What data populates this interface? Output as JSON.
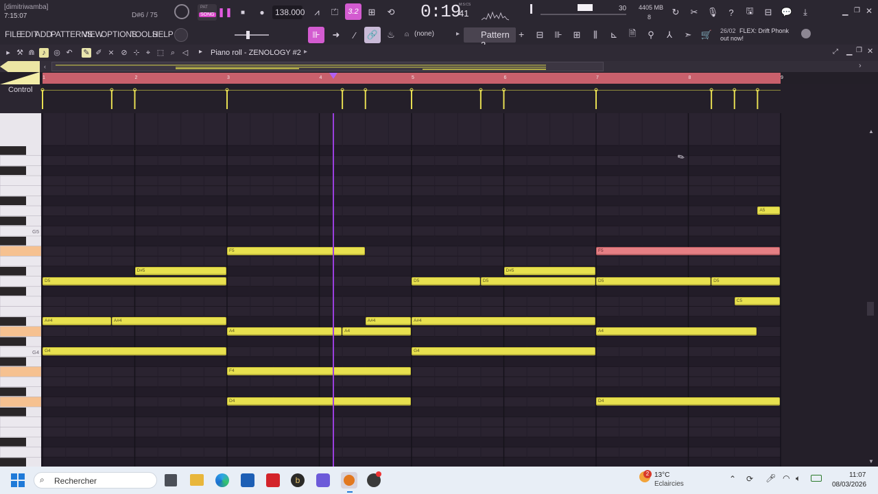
{
  "top_bar": {
    "user": "[dimitriwamba]",
    "time_pos": "7:15:07",
    "note_hint": "D#6 / 75",
    "pat_label": "PAT",
    "song_label": "SONG",
    "tempo": "138.000",
    "pattern_snap": "3.2",
    "clock": "0:19",
    "clock_sub": "41",
    "clock_unit": "M:S:CS",
    "cpu": "30",
    "mem": "4405 MB",
    "poly": "8"
  },
  "menu": {
    "items": [
      "FILE",
      "EDIT",
      "ADD",
      "PATTERNS",
      "VIEW",
      "OPTIONS",
      "TOOLS",
      "HELP"
    ],
    "none_label": "(none)",
    "pattern_name": "Pattern 2",
    "news_date": "26/02",
    "news_text": "FLEX: Drift Phonk",
    "news_text2": "out now!"
  },
  "piano_roll": {
    "title": "Piano roll - ZENOLOGY #2",
    "control_label": "Control",
    "bars": [
      "1",
      "2",
      "3",
      "4",
      "5",
      "6",
      "7",
      "8",
      "9"
    ],
    "key_labels": [
      "G5",
      "G4"
    ]
  },
  "notes": [
    {
      "name": "D5",
      "label": "D5",
      "start": 1.0,
      "len": 2.0,
      "row": "D5"
    },
    {
      "name": "D#5",
      "label": "D#5",
      "start": 2.0,
      "len": 1.0,
      "row": "D#5"
    },
    {
      "name": "A#4",
      "label": "A#4",
      "start": 1.0,
      "len": 0.75,
      "row": "A#4"
    },
    {
      "name": "A#4",
      "label": "A#4",
      "start": 1.75,
      "len": 1.25,
      "row": "A#4"
    },
    {
      "name": "G4",
      "label": "G4",
      "start": 1.0,
      "len": 2.0,
      "row": "G4"
    },
    {
      "name": "F5",
      "label": "F5",
      "start": 3.0,
      "len": 1.5,
      "row": "F5"
    },
    {
      "name": "A4",
      "label": "A4",
      "start": 3.0,
      "len": 1.25,
      "row": "A4"
    },
    {
      "name": "A4",
      "label": "A4",
      "start": 4.25,
      "len": 0.75,
      "row": "A4"
    },
    {
      "name": "A#4",
      "label": "A#4",
      "start": 4.5,
      "len": 0.5,
      "row": "A#4"
    },
    {
      "name": "F4",
      "label": "F4",
      "start": 3.0,
      "len": 2.0,
      "row": "F4"
    },
    {
      "name": "D4",
      "label": "D4",
      "start": 3.0,
      "len": 2.0,
      "row": "D4"
    },
    {
      "name": "D5",
      "label": "D5",
      "start": 5.0,
      "len": 0.75,
      "row": "D5"
    },
    {
      "name": "D5",
      "label": "D5",
      "start": 5.75,
      "len": 1.25,
      "row": "D5"
    },
    {
      "name": "D#5",
      "label": "D#5",
      "start": 6.0,
      "len": 1.0,
      "row": "D#5"
    },
    {
      "name": "A#4",
      "label": "A#4",
      "start": 5.0,
      "len": 2.0,
      "row": "A#4"
    },
    {
      "name": "G4",
      "label": "G4",
      "start": 5.0,
      "len": 2.0,
      "row": "G4"
    },
    {
      "name": "F5",
      "label": "F5",
      "start": 7.0,
      "len": 2.0,
      "row": "F5",
      "selected": true
    },
    {
      "name": "D5",
      "label": "D5",
      "start": 7.0,
      "len": 1.25,
      "row": "D5"
    },
    {
      "name": "D5",
      "label": "D5",
      "start": 8.25,
      "len": 0.75,
      "row": "D5"
    },
    {
      "name": "C5",
      "label": "C5",
      "start": 8.5,
      "len": 0.5,
      "row": "C5"
    },
    {
      "name": "A4",
      "label": "A4",
      "start": 7.0,
      "len": 1.75,
      "row": "A4"
    },
    {
      "name": "D4",
      "label": "D4",
      "start": 7.0,
      "len": 2.0,
      "row": "D4"
    },
    {
      "name": "A5",
      "label": "A5",
      "start": 8.75,
      "len": 0.25,
      "row": "A5"
    }
  ],
  "playhead_beat": 4.15,
  "taskbar": {
    "search_placeholder": "Rechercher",
    "weather_temp": "13°C",
    "weather_desc": "Eclaircies",
    "weather_badge": "2",
    "time": "11:07",
    "date": "08/03/2026"
  },
  "colors": {
    "note": "#e8e14f",
    "note_selected": "#e67f84",
    "playhead": "#9b3fe0",
    "ruler_loop": "#c9606c",
    "accent_pink": "#e050e0"
  }
}
